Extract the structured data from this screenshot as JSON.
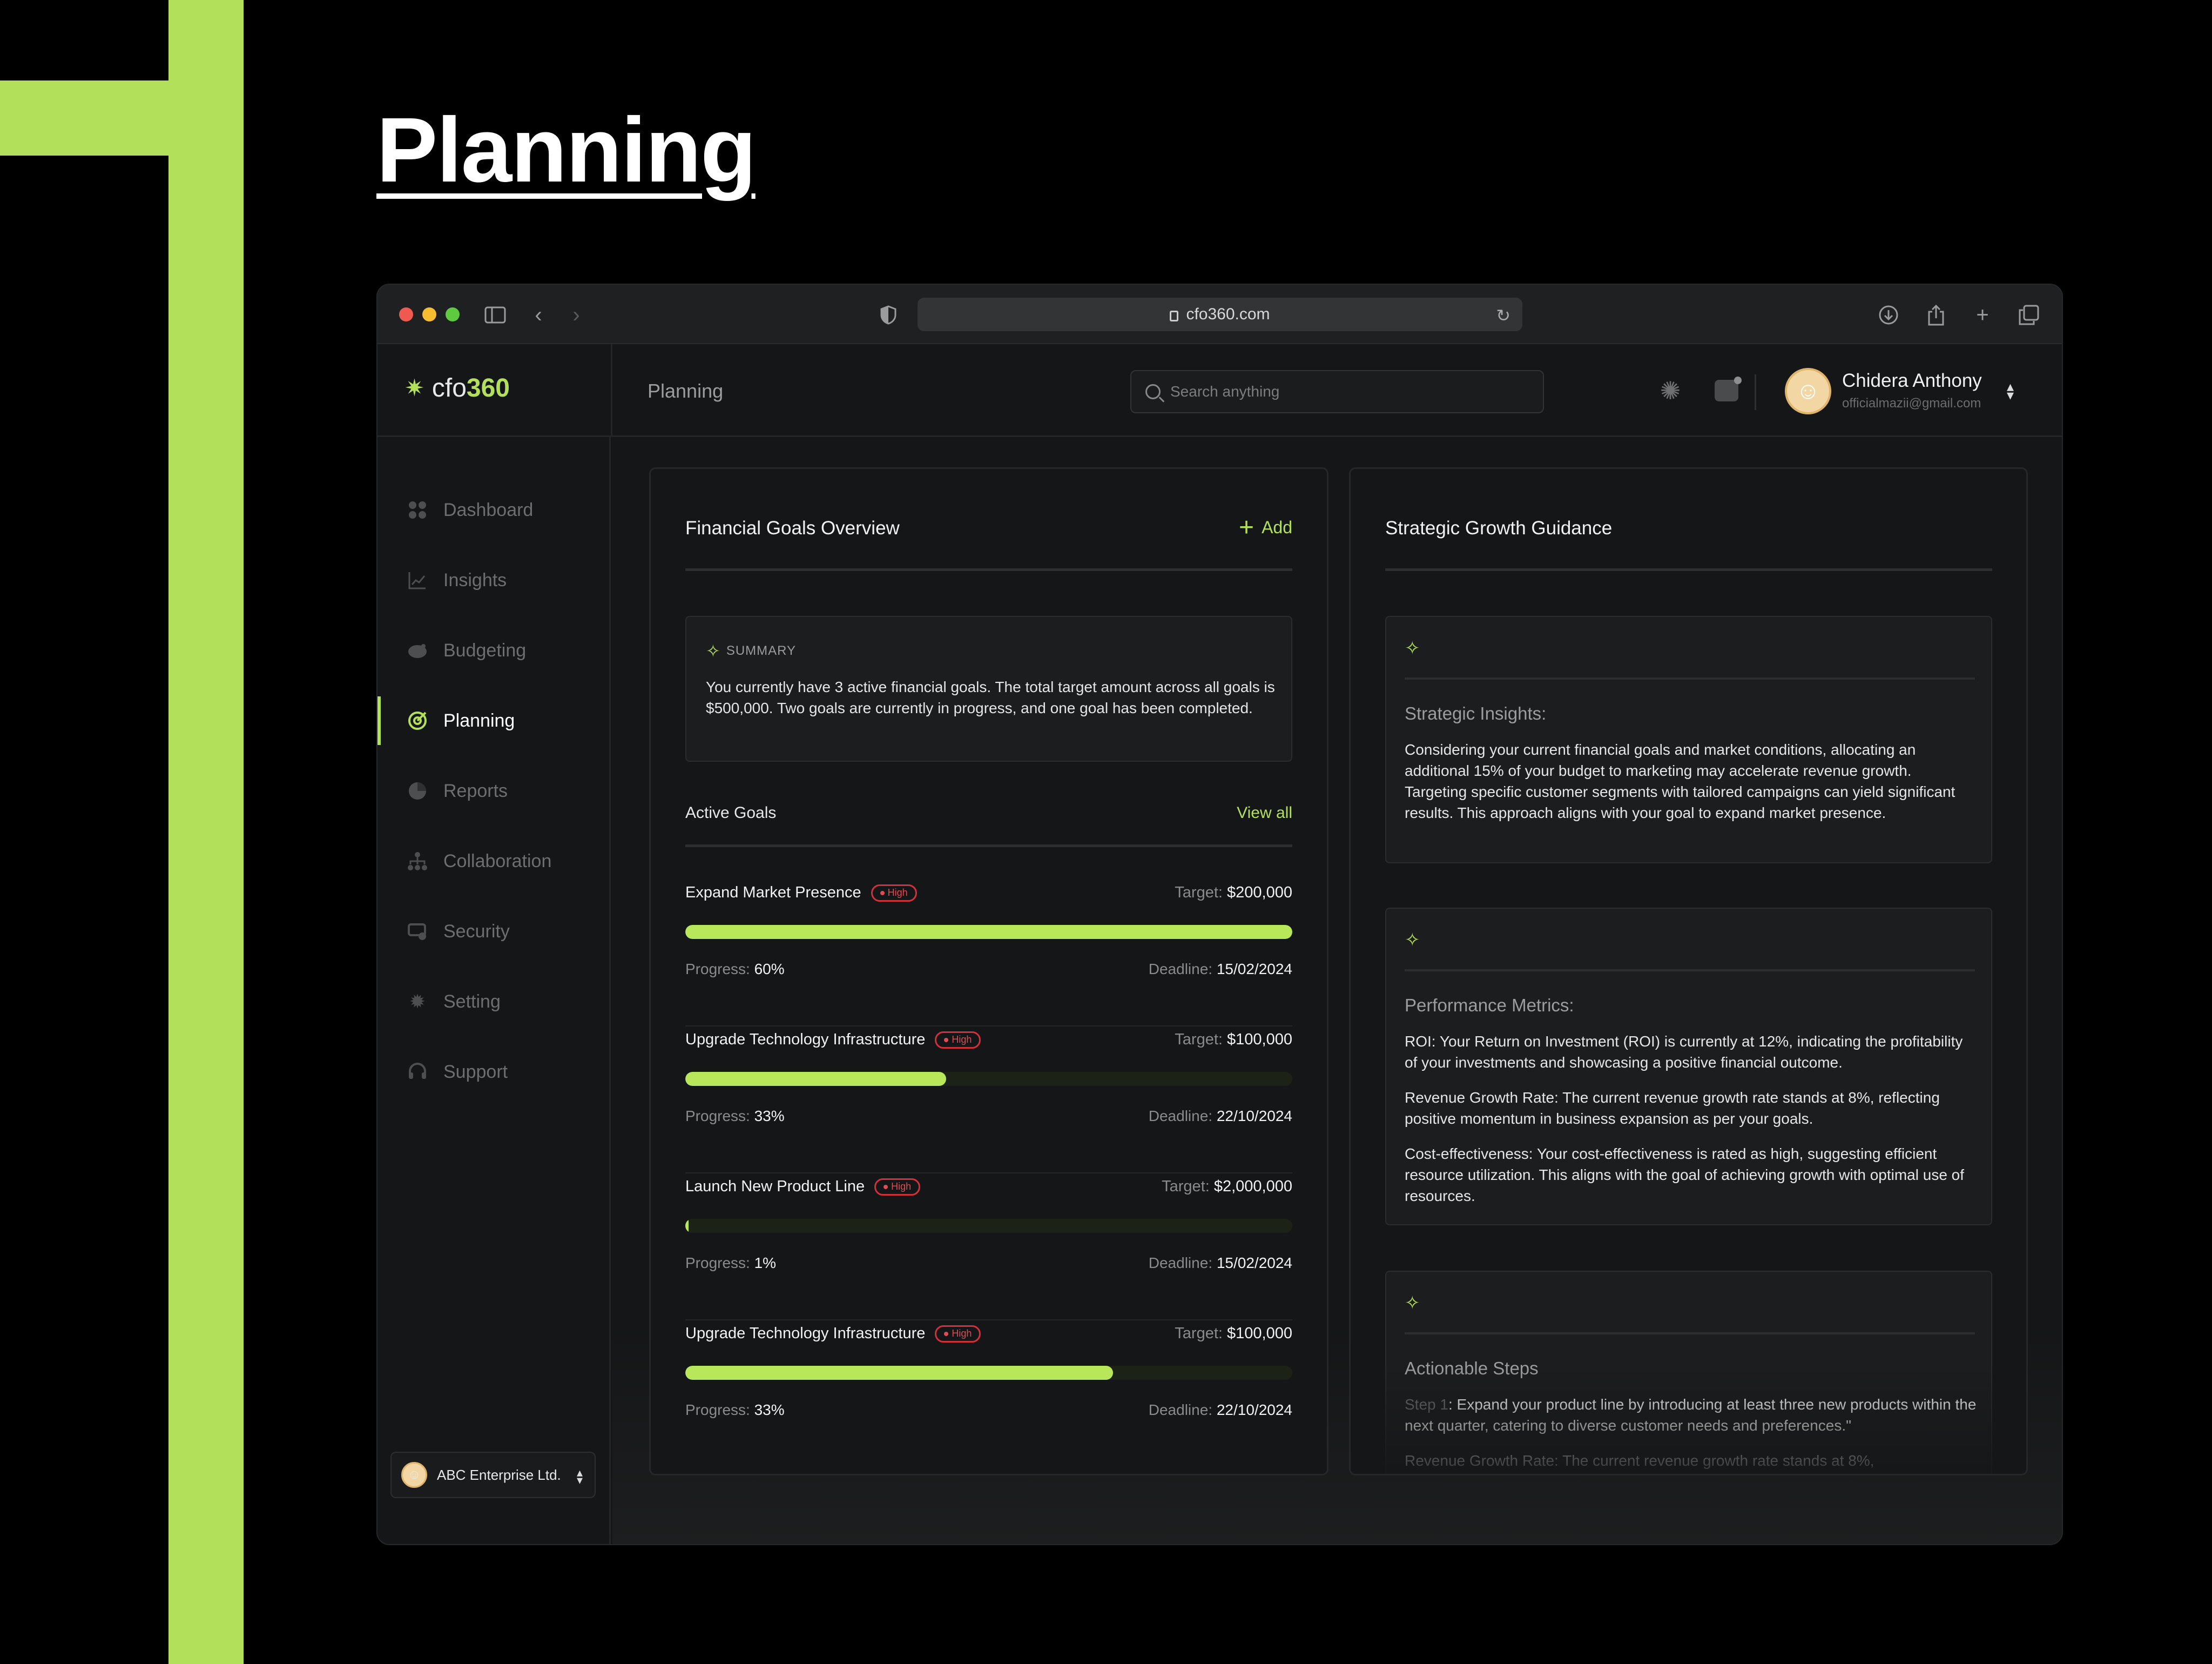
{
  "hero": {
    "title": "Planning"
  },
  "browser": {
    "url": "cfo360.com"
  },
  "app": {
    "logo_prefix": "cfo",
    "logo_number": "360",
    "breadcrumb": "Planning",
    "search_placeholder": "Search anything",
    "user": {
      "name": "Chidera Anthony",
      "email": "officialmazii@gmail.com"
    }
  },
  "sidebar": {
    "items": [
      {
        "label": "Dashboard",
        "icon": "grid-icon"
      },
      {
        "label": "Insights",
        "icon": "chart-icon"
      },
      {
        "label": "Budgeting",
        "icon": "wallet-icon"
      },
      {
        "label": "Planning",
        "icon": "target-icon",
        "active": true
      },
      {
        "label": "Reports",
        "icon": "pie-icon"
      },
      {
        "label": "Collaboration",
        "icon": "team-icon"
      },
      {
        "label": "Security",
        "icon": "shield-icon"
      },
      {
        "label": "Setting",
        "icon": "gear-icon"
      },
      {
        "label": "Support",
        "icon": "headset-icon"
      }
    ],
    "org": "ABC Enterprise Ltd."
  },
  "goals_panel": {
    "title": "Financial Goals Overview",
    "add_label": "Add",
    "summary_label": "SUMMARY",
    "summary_text": "You currently have 3 active financial goals. The total target amount across all goals is $500,000. Two goals are currently in progress, and one goal has been completed.",
    "active_title": "Active Goals",
    "view_all": "View all",
    "target_label": "Target:",
    "progress_label": "Progress:",
    "deadline_label": "Deadline:",
    "goals": [
      {
        "name": "Expand Market Presence",
        "priority": "High",
        "target": "$200,000",
        "progress": "60%",
        "fill": 1.0,
        "deadline": "15/02/2024"
      },
      {
        "name": "Upgrade Technology Infrastructure",
        "priority": "High",
        "target": "$100,000",
        "progress": "33%",
        "fill": 0.43,
        "deadline": "22/10/2024"
      },
      {
        "name": "Launch New Product Line",
        "priority": "High",
        "target": "$2,000,000",
        "progress": "1%",
        "fill": 0.005,
        "deadline": "15/02/2024"
      },
      {
        "name": "Upgrade Technology Infrastructure",
        "priority": "High",
        "target": "$100,000",
        "progress": "33%",
        "fill": 0.705,
        "deadline": "22/10/2024"
      }
    ]
  },
  "guidance_panel": {
    "title": "Strategic Growth Guidance",
    "cards": [
      {
        "title": "Strategic Insights:",
        "paragraphs": [
          "Considering your current financial goals and market conditions, allocating an additional 15% of your budget to marketing may accelerate revenue growth. Targeting specific customer segments with tailored campaigns can yield significant results. This approach aligns with your goal to expand market presence."
        ]
      },
      {
        "title": "Performance Metrics:",
        "paragraphs": [
          "ROI: Your Return on Investment (ROI) is currently at 12%, indicating the profitability of your investments and showcasing a positive financial outcome.",
          "Revenue Growth Rate: The current revenue growth rate stands at 8%, reflecting positive momentum in business expansion as per your goals.",
          "Cost-effectiveness: Your cost-effectiveness is rated as high, suggesting efficient resource utilization. This aligns with the goal of achieving growth with optimal use of resources."
        ]
      },
      {
        "title": "Actionable Steps",
        "step_label": "Step 1",
        "step_text": ": Expand your product line by introducing at least three new products within the next quarter, catering to diverse customer needs and preferences.\"",
        "paragraphs": [
          "Revenue Growth Rate: The current revenue growth rate stands at 8%,"
        ]
      }
    ]
  },
  "colors": {
    "accent": "#b3e05a",
    "badge_red": "#e14b54",
    "background": "#151617"
  }
}
